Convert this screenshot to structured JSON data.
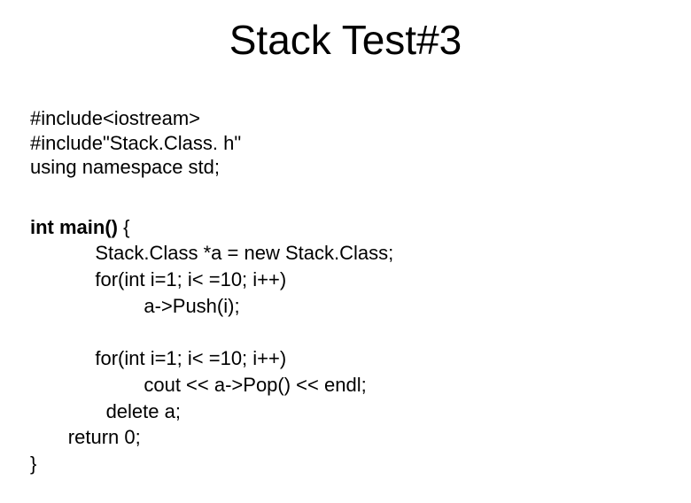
{
  "title": "Stack Test#3",
  "includes": {
    "l1": "#include<iostream>",
    "l2": "#include\"Stack.Class. h\"",
    "l3": "using namespace std;"
  },
  "code": {
    "l1a": "int main()",
    "l1b": " {",
    "l2": "            Stack.Class *a = new Stack.Class;",
    "l3": "            for(int i=1; i< =10; i++)",
    "l4": "                     a->Push(i);",
    "l5": "",
    "l6": "            for(int i=1; i< =10; i++)",
    "l7": "                     cout << a->Pop() << endl;",
    "l8": "              delete a;",
    "l9": "       return 0;",
    "l10": "}"
  }
}
